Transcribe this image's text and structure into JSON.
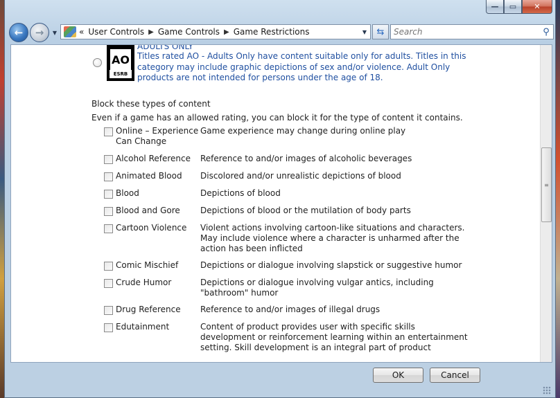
{
  "window": {
    "caption": {
      "minimize": "—",
      "maximize": "▭",
      "close": "✕"
    }
  },
  "nav": {
    "back_icon": "back-arrow-icon",
    "forward_icon": "forward-arrow-icon",
    "breadcrumb_prefix": "«",
    "breadcrumbs": [
      "User Controls",
      "Game Controls",
      "Game Restrictions"
    ],
    "search_placeholder": "Search"
  },
  "rating_ao": {
    "badge_text": "AO",
    "badge_footer": "ESRB",
    "heading": "ADULTS ONLY",
    "description": "Titles rated AO - Adults Only have content suitable only for adults.  Titles in this category may include graphic depictions of sex and/or violence.  Adult Only products are not intended for persons under the age of 18."
  },
  "block": {
    "title": "Block these types of content",
    "subtitle": "Even if a game has an allowed rating, you can block it for the type of content it contains.",
    "items": [
      {
        "label": "Online – Experience Can Change",
        "desc": "Game experience may change during online play",
        "checked": false
      },
      {
        "label": "Alcohol Reference",
        "desc": "Reference to and/or images of alcoholic beverages",
        "checked": false
      },
      {
        "label": "Animated Blood",
        "desc": "Discolored and/or unrealistic depictions of blood",
        "checked": false
      },
      {
        "label": "Blood",
        "desc": "Depictions of blood",
        "checked": false
      },
      {
        "label": "Blood and Gore",
        "desc": "Depictions of blood or the mutilation of body parts",
        "checked": false
      },
      {
        "label": "Cartoon Violence",
        "desc": "Violent actions involving cartoon-like situations and characters. May include violence where a character is unharmed after the action has been inflicted",
        "checked": false
      },
      {
        "label": "Comic Mischief",
        "desc": "Depictions or dialogue involving slapstick or suggestive humor",
        "checked": false
      },
      {
        "label": "Crude Humor",
        "desc": "Depictions or dialogue involving vulgar antics, including \"bathroom\" humor",
        "checked": false
      },
      {
        "label": "Drug Reference",
        "desc": "Reference to and/or images of illegal drugs",
        "checked": false
      },
      {
        "label": "Edutainment",
        "desc": "Content of product provides user with specific skills development or reinforcement learning within an entertainment setting.  Skill development is an integral part of product",
        "checked": false
      }
    ]
  },
  "footer": {
    "ok_label": "OK",
    "cancel_label": "Cancel"
  },
  "colors": {
    "link_blue": "#1f4fa0",
    "frame": "#bcd0e3"
  }
}
